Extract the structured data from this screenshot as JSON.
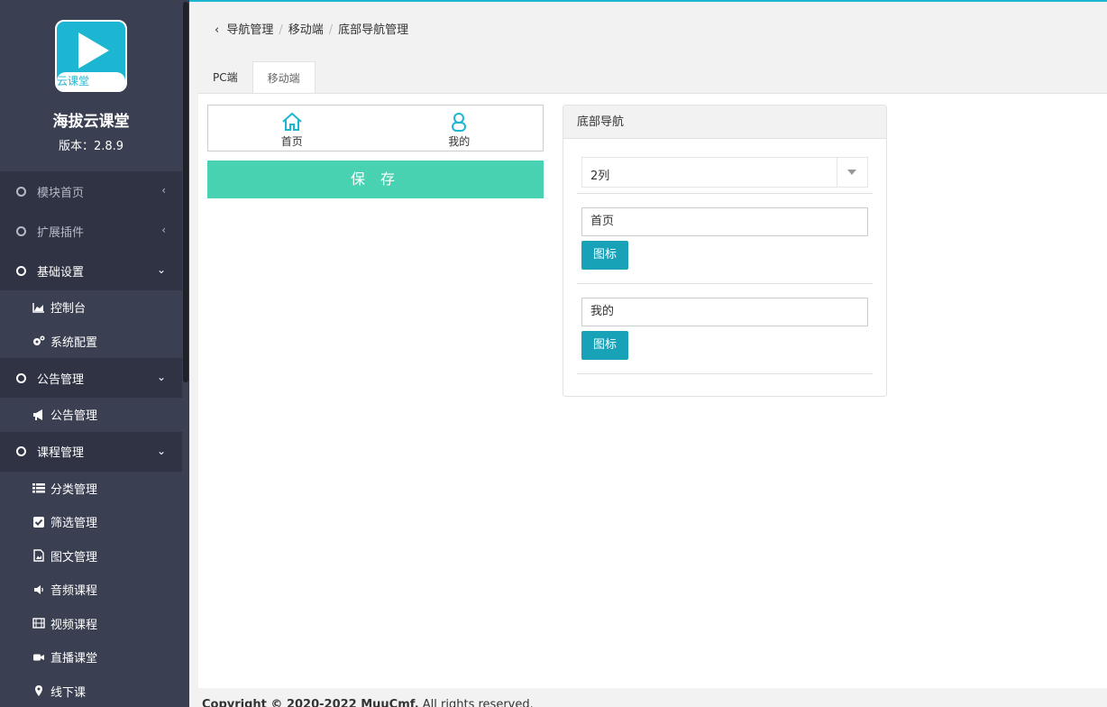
{
  "brand": {
    "logo_text": "云课堂",
    "name": "海拔云课堂",
    "version": "版本：2.8.9"
  },
  "menu": {
    "module_home": "模块首页",
    "extensions": "扩展插件",
    "basic_settings": "基础设置",
    "console": "控制台",
    "system_config": "系统配置",
    "notice_group": "公告管理",
    "notice_manage": "公告管理",
    "course_group": "课程管理",
    "category": "分类管理",
    "filter": "筛选管理",
    "graphic": "图文管理",
    "audio": "音频课程",
    "video": "视频课程",
    "live": "直播课堂",
    "offline": "线下课"
  },
  "breadcrumb": [
    "导航管理",
    "移动端",
    "底部导航管理"
  ],
  "tabs": [
    "PC端",
    "移动端"
  ],
  "preview": {
    "items": [
      "首页",
      "我的"
    ]
  },
  "save_label": "保 存",
  "panel": {
    "title": "底部导航",
    "columns_value": "2列",
    "items": [
      {
        "name": "首页",
        "icon_button": "图标"
      },
      {
        "name": "我的",
        "icon_button": "图标"
      }
    ]
  },
  "footer": {
    "copyright": "Copyright © 2020-2022 MuuCmf.",
    "rights": " All rights reserved."
  },
  "colors": {
    "sidebar": "#3a3f51",
    "accent": "#1cb6d2",
    "save": "#48d2b1",
    "icon_button": "#18a2b8"
  }
}
